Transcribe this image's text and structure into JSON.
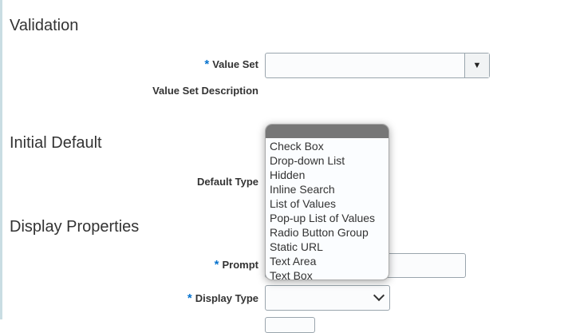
{
  "sections": {
    "validation": "Validation",
    "initial_default": "Initial Default",
    "display_properties": "Display Properties"
  },
  "fields": {
    "value_set": {
      "label": "Value Set",
      "required": "*",
      "value": ""
    },
    "value_set_description": {
      "label": "Value Set Description"
    },
    "default_type": {
      "label": "Default Type"
    },
    "prompt": {
      "label": "Prompt",
      "required": "*",
      "value": ""
    },
    "display_type": {
      "label": "Display Type",
      "required": "*",
      "value": ""
    }
  },
  "dropdown": {
    "options": [
      "Check Box",
      "Drop-down List",
      "Hidden",
      "Inline Search",
      "List of Values",
      "Pop-up List of Values",
      "Radio Button Group",
      "Static URL",
      "Text Area",
      "Text Box"
    ]
  }
}
